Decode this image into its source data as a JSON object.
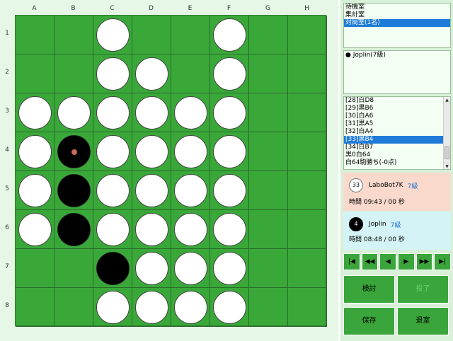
{
  "board": {
    "columns": [
      "A",
      "B",
      "C",
      "D",
      "E",
      "F",
      "G",
      "H"
    ],
    "rows": [
      "1",
      "2",
      "3",
      "4",
      "5",
      "6",
      "7",
      "8"
    ],
    "grid": [
      [
        "",
        "",
        "W",
        "",
        "",
        "W",
        "",
        ""
      ],
      [
        "",
        "",
        "W",
        "W",
        "",
        "W",
        "",
        ""
      ],
      [
        "W",
        "W",
        "W",
        "W",
        "W",
        "W",
        "",
        ""
      ],
      [
        "W",
        "B",
        "W",
        "W",
        "W",
        "W",
        "",
        ""
      ],
      [
        "W",
        "B",
        "W",
        "W",
        "W",
        "W",
        "",
        ""
      ],
      [
        "W",
        "B",
        "W",
        "W",
        "W",
        "W",
        "",
        ""
      ],
      [
        "",
        "",
        "B",
        "W",
        "W",
        "W",
        "",
        ""
      ],
      [
        "",
        "",
        "W",
        "W",
        "W",
        "W",
        "",
        ""
      ]
    ],
    "last_move": "B4"
  },
  "rooms": {
    "items": [
      "待機室",
      "集計室",
      "対局室(1名)"
    ],
    "selected_index": 2
  },
  "spectators": {
    "items": [
      "● Joplin(7級)"
    ]
  },
  "moves": {
    "items": [
      "[28]白D8",
      "[29]黒B6",
      "[30]白A6",
      "[31]黒A5",
      "[32]白A4",
      "[33]黒B4",
      "[34]白B7",
      "黒0白64",
      "白64駒勝ち(-0点)"
    ],
    "selected_index": 5
  },
  "player_white": {
    "disc_count": "33",
    "name": "LaboBot7K",
    "rank": "7級",
    "time": "時間 09:43 / 00 秒",
    "color": "#f9d9cc"
  },
  "player_black": {
    "disc_count": "4",
    "name": "Joplin",
    "rank": "7級",
    "time": "時間 08:48 / 00 秒",
    "color": "#d4f3f6"
  },
  "nav": {
    "first": "|◀",
    "prev_fast": "◀◀",
    "prev": "◀",
    "next": "▶",
    "next_fast": "▶▶",
    "last": "▶|"
  },
  "buttons": {
    "review": "検討",
    "resign": "投了",
    "save": "保存",
    "leave": "退室"
  },
  "colors": {
    "board_green": "#39a839",
    "selection_blue": "#1e7bd8",
    "button_green": "#3aa53a"
  }
}
